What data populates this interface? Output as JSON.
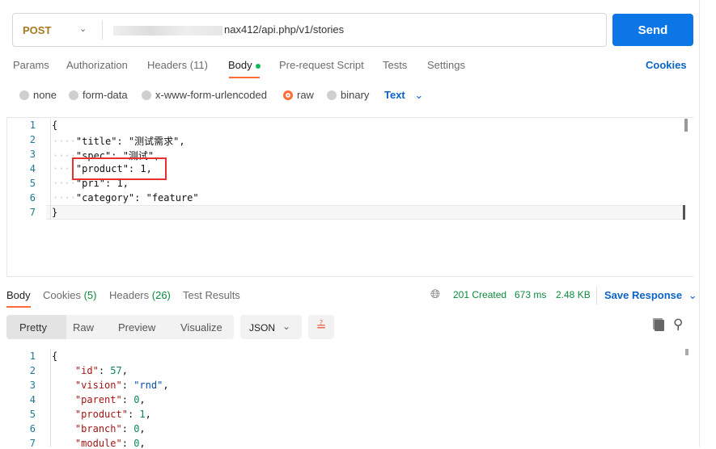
{
  "request": {
    "method": "POST",
    "url_visible": "nax412/api.php/v1/stories",
    "send_label": "Send"
  },
  "tabs": [
    {
      "label": "Params"
    },
    {
      "label": "Authorization"
    },
    {
      "label": "Headers (11)"
    },
    {
      "label": "Body"
    },
    {
      "label": "Pre-request Script"
    },
    {
      "label": "Tests"
    },
    {
      "label": "Settings"
    }
  ],
  "cookies_label": "Cookies",
  "body_types": [
    {
      "label": "none"
    },
    {
      "label": "form-data"
    },
    {
      "label": "x-www-form-urlencoded"
    },
    {
      "label": "raw"
    },
    {
      "label": "binary"
    }
  ],
  "raw_type": "Text",
  "request_body": {
    "line_numbers": [
      "1",
      "2",
      "3",
      "4",
      "5",
      "6",
      "7"
    ],
    "lines": [
      "{",
      "\"title\": \"测试需求\",",
      "\"spec\": \"测试\",",
      "\"product\": 1,",
      "\"pri\": 1,",
      "\"category\": \"feature\"",
      "}"
    ]
  },
  "response": {
    "tabs": {
      "body": "Body",
      "cookies": "Cookies",
      "cookies_count": "(5)",
      "headers": "Headers",
      "headers_count": "(26)",
      "tests": "Test Results"
    },
    "status": "201 Created",
    "time": "673 ms",
    "size": "2.48 KB",
    "save_label": "Save Response",
    "views": [
      "Pretty",
      "Raw",
      "Preview",
      "Visualize"
    ],
    "format": "JSON",
    "line_numbers": [
      "1",
      "2",
      "3",
      "4",
      "5",
      "6",
      "7"
    ],
    "lines": [
      {
        "key": "id",
        "value": "57",
        "type": "number"
      },
      {
        "key": "vision",
        "value": "\"rnd\"",
        "type": "string"
      },
      {
        "key": "parent",
        "value": "0",
        "type": "number"
      },
      {
        "key": "product",
        "value": "1",
        "type": "number"
      },
      {
        "key": "branch",
        "value": "0",
        "type": "number"
      },
      {
        "key": "module",
        "value": "0",
        "type": "number"
      }
    ]
  }
}
